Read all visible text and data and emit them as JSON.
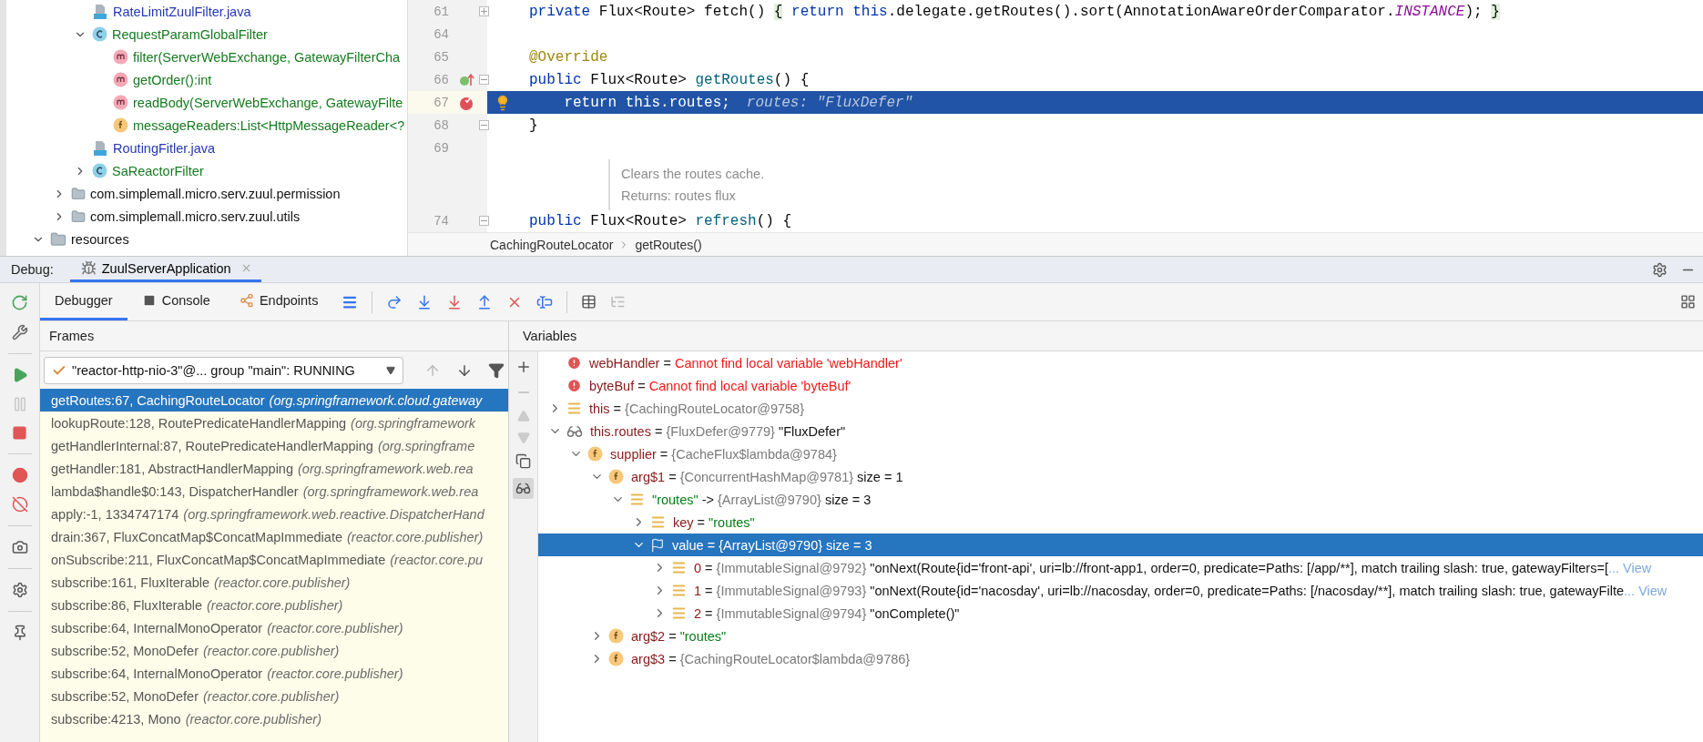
{
  "project_tree": {
    "items": [
      {
        "children": [
          {
            "children": [
              {
                "label": "RateLimitZuulFilter.java",
                "kind": "java-file"
              },
              {
                "label": "RequestParamGlobalFilter",
                "kind": "class",
                "expanded": true,
                "children": [
                  {
                    "label": "filter(ServerWebExchange, GatewayFilterCha",
                    "kind": "method"
                  },
                  {
                    "label": "getOrder():int",
                    "kind": "method"
                  },
                  {
                    "label": "readBody(ServerWebExchange, GatewayFilte",
                    "kind": "method"
                  },
                  {
                    "label": "messageReaders:List<HttpMessageReader<?",
                    "kind": "field"
                  }
                ]
              },
              {
                "label": "RoutingFitler.java",
                "kind": "java-file"
              },
              {
                "label": "SaReactorFilter",
                "kind": "class",
                "expanded": false
              }
            ]
          },
          {
            "label": "com.simplemall.micro.serv.zuul.permission",
            "kind": "package",
            "expanded": false
          },
          {
            "label": "com.simplemall.micro.serv.zuul.utils",
            "kind": "package",
            "expanded": false
          }
        ]
      },
      {
        "label": "resources",
        "kind": "resources",
        "expanded": true
      }
    ]
  },
  "editor": {
    "lines": [
      {
        "kind": "code",
        "number": "61",
        "collapsed": true,
        "segments": [
          {
            "kind": "keyword",
            "text": "private "
          },
          {
            "kind": "plain",
            "text": "Flux<Route> fetch() "
          },
          {
            "kind": "folded",
            "text": "{"
          },
          {
            "kind": "keyword",
            "text": " return this"
          },
          {
            "kind": "plain",
            "text": ".delegate.getRoutes().sort(AnnotationAwareOrderComparator."
          },
          {
            "kind": "constant",
            "text": "INSTANCE"
          },
          {
            "kind": "plain",
            "text": "); "
          },
          {
            "kind": "folded",
            "text": "}"
          }
        ]
      },
      {
        "kind": "code",
        "number": "64"
      },
      {
        "kind": "code",
        "number": "65",
        "segments": [
          {
            "kind": "annotation",
            "text": "@Override"
          }
        ]
      },
      {
        "kind": "code",
        "number": "66",
        "overrides": true,
        "collapsed": false,
        "segments": [
          {
            "kind": "keyword",
            "text": "public "
          },
          {
            "kind": "plain",
            "text": "Flux<Route> "
          },
          {
            "kind": "method",
            "text": "getRoutes"
          },
          {
            "kind": "plain",
            "text": "() {"
          }
        ]
      },
      {
        "kind": "code",
        "number": "67",
        "breakpoint": true,
        "current": true,
        "intention": true,
        "segments": [
          {
            "kind": "keyword",
            "text": "    return "
          },
          {
            "kind": "keyword",
            "text": "this"
          },
          {
            "kind": "plain",
            "text": ".routes;"
          },
          {
            "kind": "hint",
            "text": "routes: \"FluxDefer\""
          }
        ]
      },
      {
        "kind": "code",
        "number": "68",
        "collapsed": false,
        "segments": [
          {
            "kind": "plain",
            "text": "}"
          }
        ]
      },
      {
        "kind": "code",
        "number": "69"
      },
      {
        "kind": "doc",
        "texts": [
          "Clears the routes cache.",
          "Returns: routes flux"
        ]
      },
      {
        "kind": "code",
        "number": "74",
        "collapsed": false,
        "segments": [
          {
            "kind": "keyword",
            "text": "public "
          },
          {
            "kind": "plain",
            "text": "Flux<Route> "
          },
          {
            "kind": "method",
            "text": "refresh"
          },
          {
            "kind": "plain",
            "text": "() {"
          }
        ]
      }
    ],
    "breadcrumbs": [
      "CachingRouteLocator",
      "getRoutes()"
    ]
  },
  "debug": {
    "label": "Debug:",
    "session": "ZuulServerApplication",
    "tabs": [
      {
        "label": "Debugger",
        "kind": "plain",
        "selected": true
      },
      {
        "label": "Console",
        "kind": "console",
        "selected": false
      },
      {
        "label": "Endpoints",
        "kind": "endpoints",
        "selected": false
      }
    ],
    "frames": {
      "title": "Frames",
      "thread": "\"reactor-http-nio-3\"@... group \"main\": RUNNING",
      "items": [
        {
          "method": "getRoutes:67, CachingRouteLocator",
          "location": "(org.springframework.cloud.gateway",
          "selected": true
        },
        {
          "method": "lookupRoute:128, RoutePredicateHandlerMapping",
          "location": "(org.springframework",
          "selected": false
        },
        {
          "method": "getHandlerInternal:87, RoutePredicateHandlerMapping",
          "location": "(org.springframe",
          "selected": false
        },
        {
          "method": "getHandler:181, AbstractHandlerMapping",
          "location": "(org.springframework.web.rea",
          "selected": false
        },
        {
          "method": "lambda$handle$0:143, DispatcherHandler",
          "location": "(org.springframework.web.rea",
          "selected": false
        },
        {
          "method": "apply:-1, 1334747174",
          "location": "(org.springframework.web.reactive.DispatcherHand",
          "selected": false
        },
        {
          "method": "drain:367, FluxConcatMap$ConcatMapImmediate",
          "location": "(reactor.core.publisher)",
          "selected": false
        },
        {
          "method": "onSubscribe:211, FluxConcatMap$ConcatMapImmediate",
          "location": "(reactor.core.pu",
          "selected": false
        },
        {
          "method": "subscribe:161, FluxIterable",
          "location": "(reactor.core.publisher)",
          "selected": false
        },
        {
          "method": "subscribe:86, FluxIterable",
          "location": "(reactor.core.publisher)",
          "selected": false
        },
        {
          "method": "subscribe:64, InternalMonoOperator",
          "location": "(reactor.core.publisher)",
          "selected": false
        },
        {
          "method": "subscribe:52, MonoDefer",
          "location": "(reactor.core.publisher)",
          "selected": false
        },
        {
          "method": "subscribe:64, InternalMonoOperator",
          "location": "(reactor.core.publisher)",
          "selected": false
        },
        {
          "method": "subscribe:52, MonoDefer",
          "location": "(reactor.core.publisher)",
          "selected": false
        },
        {
          "method": "subscribe:4213, Mono",
          "location": "(reactor.core.publisher)",
          "selected": false
        }
      ]
    },
    "variables": {
      "title": "Variables",
      "items": [
        {
          "kind": "error",
          "name": "webHandler",
          "op": "=",
          "error": "Cannot find local variable 'webHandler'",
          "selected": false
        },
        {
          "kind": "error",
          "name": "byteBuf",
          "op": "=",
          "error": "Cannot find local variable 'byteBuf'",
          "selected": false
        },
        {
          "kind": "object",
          "name": "this",
          "op": "=",
          "ref": "{CachingRouteLocator@9758}",
          "expanded": false,
          "selected": false
        },
        {
          "kind": "watch",
          "name": "this.routes",
          "op": "=",
          "ref": "{FluxDefer@9779}",
          "note": "\"FluxDefer\"",
          "expanded": true,
          "selected": false,
          "children": [
            {
              "kind": "field",
              "name": "supplier",
              "op": "=",
              "ref": "{CacheFlux$lambda@9784}",
              "expanded": true,
              "selected": false,
              "children": [
                {
                  "kind": "field",
                  "name": "arg$1",
                  "op": "=",
                  "ref": "{ConcurrentHashMap@9781}",
                  "note": "size = 1",
                  "expanded": true,
                  "selected": false,
                  "children": [
                    {
                      "kind": "object",
                      "key": "\"routes\"",
                      "op": "->",
                      "ref": "{ArrayList@9790}",
                      "note": "size = 3",
                      "expanded": true,
                      "selected": false,
                      "children": [
                        {
                          "kind": "object",
                          "name": "key",
                          "op": "=",
                          "string": "\"routes\"",
                          "expanded": false,
                          "selected": false
                        },
                        {
                          "kind": "marked",
                          "name": "value",
                          "op": "=",
                          "ref": "{ArrayList@9790}",
                          "note": "size = 3",
                          "expanded": true,
                          "selected": true,
                          "children": [
                            {
                              "kind": "object",
                              "name": "0",
                              "op": "=",
                              "ref": "{ImmutableSignal@9792}",
                              "note": "\"onNext(Route{id='front-api', uri=lb://front-app1, order=0, predicate=Paths: [/app/**], match trailing slash: true, gatewayFilters=[",
                              "more": "... View",
                              "expanded": false,
                              "selected": false
                            },
                            {
                              "kind": "object",
                              "name": "1",
                              "op": "=",
                              "ref": "{ImmutableSignal@9793}",
                              "note": "\"onNext(Route{id='nacosday', uri=lb://nacosday, order=0, predicate=Paths: [/nacosday/**], match trailing slash: true, gatewayFilte",
                              "more": "... View",
                              "expanded": false,
                              "selected": false
                            },
                            {
                              "kind": "object",
                              "name": "2",
                              "op": "=",
                              "ref": "{ImmutableSignal@9794}",
                              "note": "\"onComplete()\"",
                              "expanded": false,
                              "selected": false
                            }
                          ]
                        }
                      ]
                    }
                  ]
                },
                {
                  "kind": "field",
                  "name": "arg$2",
                  "op": "=",
                  "string": "\"routes\"",
                  "expanded": false,
                  "selected": false
                },
                {
                  "kind": "field",
                  "name": "arg$3",
                  "op": "=",
                  "ref": "{CachingRouteLocator$lambda@9786}",
                  "expanded": false,
                  "selected": false
                }
              ]
            }
          ]
        }
      ]
    }
  }
}
